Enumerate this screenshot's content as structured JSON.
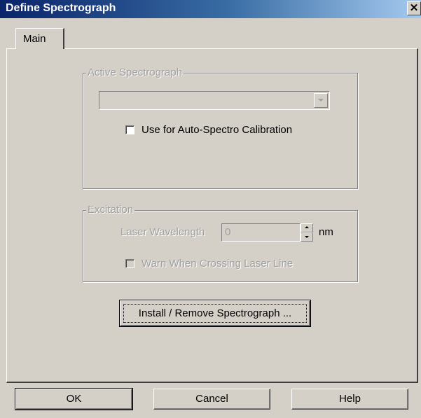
{
  "window": {
    "title": "Define Spectrograph",
    "close_symbol": "✕"
  },
  "tabs": [
    {
      "label": "Main",
      "selected": true
    }
  ],
  "active_spectrograph": {
    "legend": "Active Spectrograph",
    "combo_value": "",
    "auto_calibration_label": "Use for Auto-Spectro Calibration",
    "auto_calibration_checked": false
  },
  "excitation": {
    "legend": "Excitation",
    "laser_wavelength_label": "Laser Wavelength",
    "laser_wavelength_value": "0",
    "unit": "nm",
    "warn_label": "Warn When Crossing Laser Line",
    "warn_checked": false
  },
  "install_button_label": "Install / Remove Spectrograph ...",
  "buttons": {
    "ok": "OK",
    "cancel": "Cancel",
    "help": "Help"
  }
}
